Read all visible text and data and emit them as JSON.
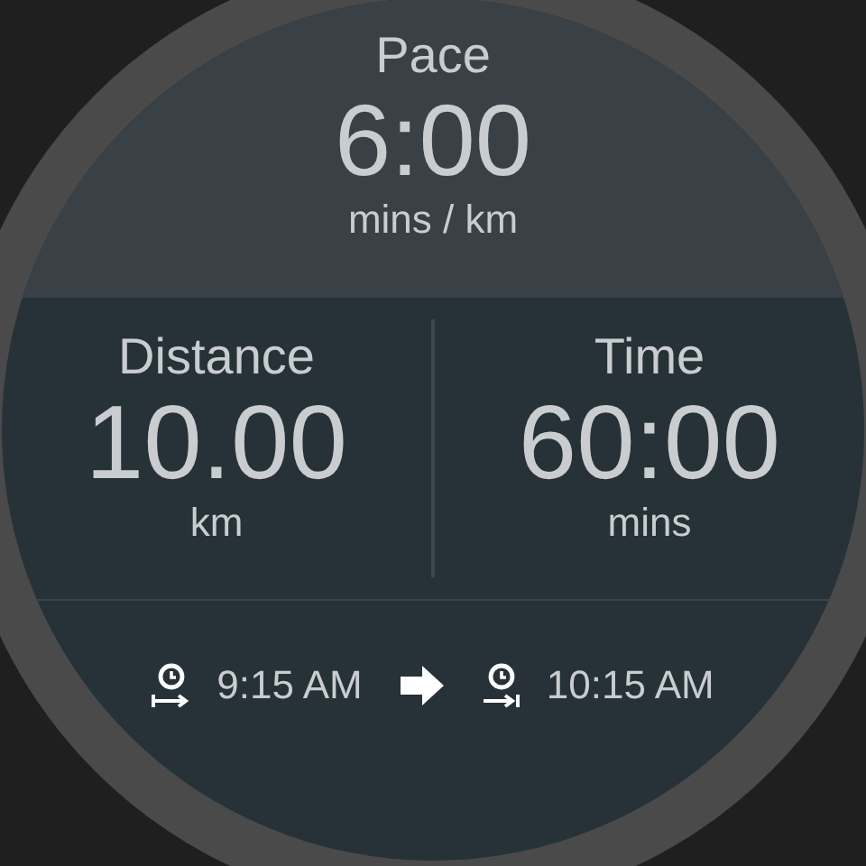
{
  "pace": {
    "label": "Pace",
    "value": "6:00",
    "unit": "mins / km"
  },
  "stats": [
    {
      "label": "Distance",
      "value": "10.00",
      "unit": "km"
    },
    {
      "label": "Time",
      "value": "60:00",
      "unit": "mins"
    }
  ],
  "schedule": {
    "start": "9:15 AM",
    "end": "10:15 AM"
  }
}
